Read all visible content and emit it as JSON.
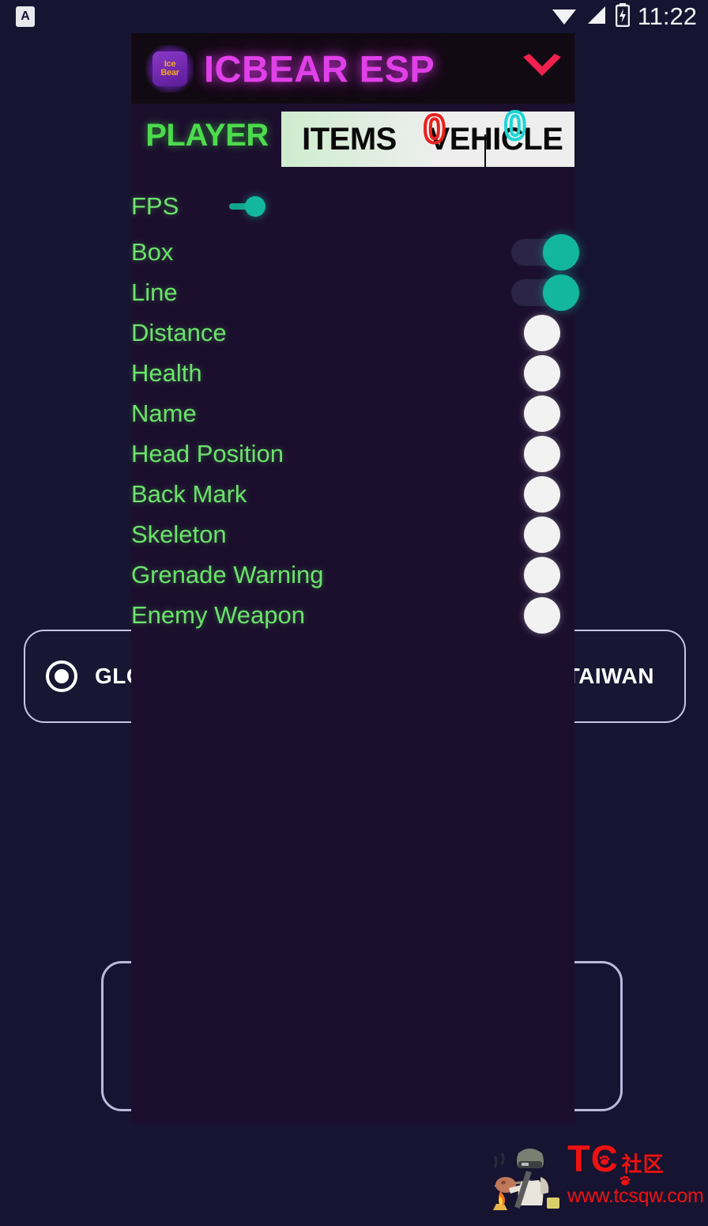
{
  "status_bar": {
    "app_badge": "A",
    "clock": "11:22",
    "icons": [
      "wifi-icon",
      "cellular-signal-icon",
      "battery-icon"
    ]
  },
  "panel": {
    "title": "ICBEAR ESP",
    "logo_line1": "Ice",
    "logo_line2": "Bear",
    "collapse_icon": "chevron-down-icon",
    "accent_title_color": "#e040e8",
    "accent_toggle_color": "#13b79d",
    "label_color": "#6ce26c",
    "tabs": [
      {
        "label": "PLAYER",
        "selected": true
      },
      {
        "label": "ITEMS",
        "selected": false
      },
      {
        "label": "VEHICLE",
        "selected": false
      }
    ],
    "overlay_digits": [
      {
        "value": "0",
        "color": "#e8211c"
      },
      {
        "value": "0",
        "color": "#1fd6d6"
      }
    ],
    "options": [
      {
        "label": "FPS",
        "state": "on",
        "toggle_style": "small-inline"
      },
      {
        "label": "Box",
        "state": "on",
        "toggle_style": "right-on"
      },
      {
        "label": "Line",
        "state": "on",
        "toggle_style": "right-on"
      },
      {
        "label": "Distance",
        "state": "off",
        "toggle_style": "right-off"
      },
      {
        "label": "Health",
        "state": "off",
        "toggle_style": "right-off"
      },
      {
        "label": "Name",
        "state": "off",
        "toggle_style": "right-off"
      },
      {
        "label": "Head Position",
        "state": "off",
        "toggle_style": "right-off"
      },
      {
        "label": "Back Mark",
        "state": "off",
        "toggle_style": "right-off"
      },
      {
        "label": "Skeleton",
        "state": "off",
        "toggle_style": "right-off"
      },
      {
        "label": "Grenade Warning",
        "state": "off",
        "toggle_style": "right-off"
      },
      {
        "label": "Enemy Weapon",
        "state": "off",
        "toggle_style": "right-off"
      }
    ]
  },
  "region_selector": {
    "options": [
      {
        "label": "GLOBAL",
        "selected": true
      },
      {
        "label": "TAIWAN",
        "selected": false
      }
    ]
  },
  "watermark": {
    "brand": "TC",
    "brand_suffix": "社区",
    "url": "www.tcsqw.com",
    "color": "#ef1111"
  }
}
